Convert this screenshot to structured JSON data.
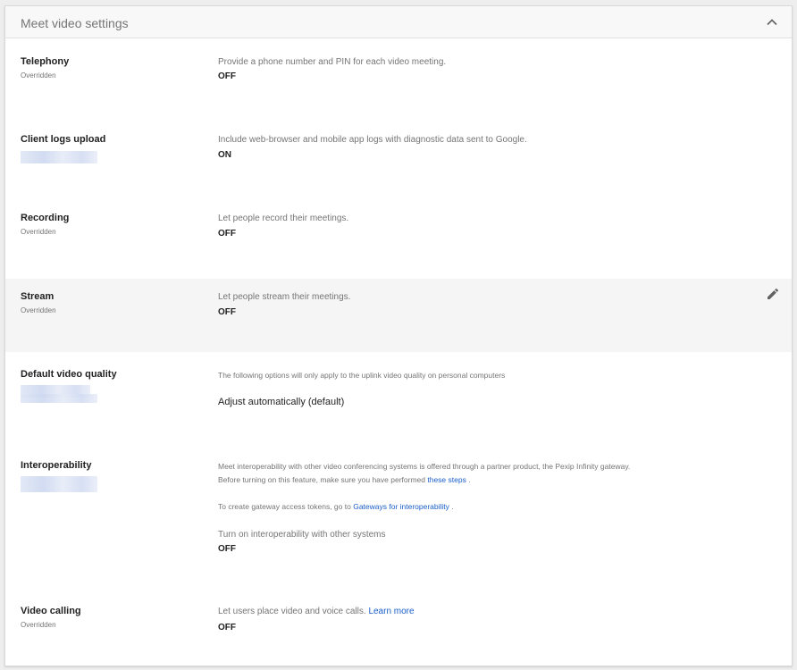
{
  "header": {
    "title": "Meet video settings"
  },
  "settings": {
    "telephony": {
      "name": "Telephony",
      "status": "Overridden",
      "description": "Provide a phone number and PIN for each video meeting.",
      "value": "OFF"
    },
    "client_logs": {
      "name": "Client logs upload",
      "description": "Include web-browser and mobile app logs with diagnostic data sent to Google.",
      "value": "ON"
    },
    "recording": {
      "name": "Recording",
      "status": "Overridden",
      "description": "Let people record their meetings.",
      "value": "OFF"
    },
    "stream": {
      "name": "Stream",
      "status": "Overridden",
      "description": "Let people stream their meetings.",
      "value": "OFF"
    },
    "video_quality": {
      "name": "Default video quality",
      "description": "The following options will only apply to the uplink video quality on personal computers",
      "value": "Adjust automatically (default)"
    },
    "interoperability": {
      "name": "Interoperability",
      "description_line1": "Meet interoperability with other video conferencing systems is offered through a partner product, the Pexip Infinity gateway.",
      "description_line2_prefix": "Before turning on this feature, make sure you have performed ",
      "description_line2_link": "these steps",
      "description_line2_suffix": " .",
      "tokens_prefix": "To create gateway access tokens, go to ",
      "tokens_link": "Gateways for interoperability",
      "tokens_suffix": " .",
      "toggle_label": "Turn on interoperability with other systems",
      "value": "OFF"
    },
    "video_calling": {
      "name": "Video calling",
      "status": "Overridden",
      "description": "Let users place video and voice calls. ",
      "learn_more": "Learn more",
      "value": "OFF"
    }
  },
  "icons": {
    "collapse": "chevron-up-icon",
    "edit": "pencil-icon"
  },
  "colors": {
    "link": "#1a5ec9",
    "highlight_row": "#f5f5f5",
    "header_bg": "#f8f8f8"
  }
}
